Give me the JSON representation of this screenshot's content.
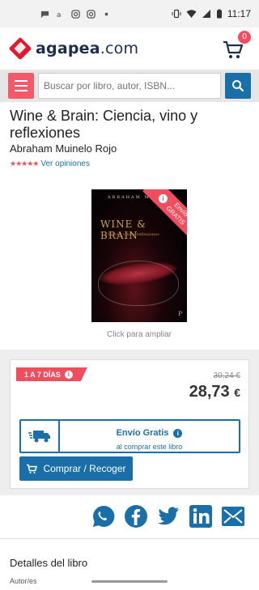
{
  "status_bar": {
    "time": "11:17"
  },
  "header": {
    "logo_name": "agapea",
    "logo_domain": ".com",
    "cart_count": "0"
  },
  "search": {
    "placeholder": "Buscar por libro, autor, ISBN..."
  },
  "product": {
    "title": "Wine & Brain: Ciencia, vino y reflexiones",
    "author": "Abraham Muinelo Rojo",
    "stars": "★★★★★",
    "opinions_label": "Ver opiniones",
    "cover": {
      "author": "ABRAHAM M",
      "title": "WINE & BRAIN",
      "subtitle": "Ciencia, vino y reflexiones",
      "publisher": "P"
    },
    "ribbon_line1": "Envío",
    "ribbon_line2": "GRATIS",
    "click_zoom": "Click para ampliar"
  },
  "pricing": {
    "delivery_tag": "1 A 7 DÍAS",
    "old_price": "30,24 €",
    "new_price": "28,73",
    "currency": "€",
    "shipping_title": "Envío Gratis",
    "shipping_sub": "al comprar este libro",
    "buy_label": "Comprar / Recoger"
  },
  "share": {
    "icons": [
      "whatsapp-icon",
      "facebook-icon",
      "twitter-icon",
      "linkedin-icon",
      "email-icon"
    ]
  },
  "details": {
    "title": "Detalles del libro",
    "first_label": "Autor/es"
  },
  "colors": {
    "accent": "#f04e5e",
    "primary": "#1b6fa8",
    "brand_dark": "#1c2d4e"
  }
}
